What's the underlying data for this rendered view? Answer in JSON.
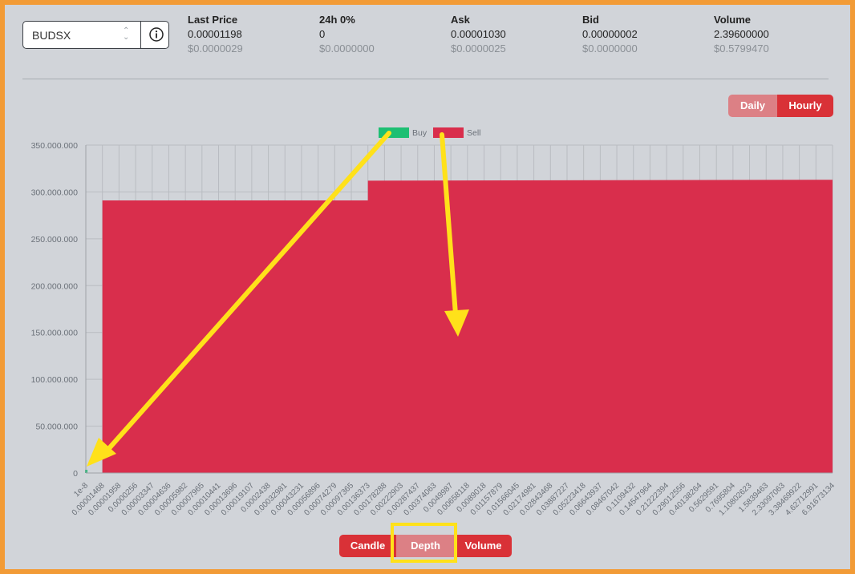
{
  "pair_select": {
    "value": "BUDSX"
  },
  "stats": [
    {
      "label": "Last Price",
      "value": "0.00001198",
      "usd": "$0.0000029"
    },
    {
      "label": "24h 0%",
      "value": "0",
      "usd": "$0.0000000"
    },
    {
      "label": "Ask",
      "value": "0.00001030",
      "usd": "$0.0000025"
    },
    {
      "label": "Bid",
      "value": "0.00000002",
      "usd": "$0.0000000"
    },
    {
      "label": "Volume",
      "value": "2.39600000",
      "usd": "$0.5799470"
    }
  ],
  "period_toggle": {
    "daily": "Daily",
    "hourly": "Hourly",
    "active": "Hourly"
  },
  "chart_tabs": {
    "candle": "Candle",
    "depth": "Depth",
    "volume": "Volume",
    "active": "Depth"
  },
  "colors": {
    "accent": "#d93137",
    "accent_light": "#dc8085",
    "buy": "#1dbf73",
    "sell": "#d92e4c",
    "annotation": "#ffe11a"
  },
  "chart_data": {
    "type": "area",
    "legend": [
      {
        "name": "Buy",
        "color": "#1dbf73"
      },
      {
        "name": "Sell",
        "color": "#d92e4c"
      }
    ],
    "legend_position": "top-center",
    "grid": true,
    "ylim": [
      0,
      350000000
    ],
    "yticks": [
      "350.000.000",
      "300.000.000",
      "250.000.000",
      "200.000.000",
      "150.000.000",
      "100.000.000",
      "50.000.000",
      "0"
    ],
    "xticks": [
      "1e-8",
      "0.00001468",
      "0.00001958",
      "0.0000256",
      "0.00003347",
      "0.00004636",
      "0.00005982",
      "0.00007965",
      "0.00010441",
      "0.00013696",
      "0.00019107",
      "0.0002438",
      "0.00032981",
      "0.00043231",
      "0.00056896",
      "0.00074279",
      "0.00097365",
      "0.00136373",
      "0.00178288",
      "0.00222903",
      "0.00287437",
      "0.00374063",
      "0.0049987",
      "0.00658118",
      "0.0089018",
      "0.01157879",
      "0.01566045",
      "0.02174981",
      "0.02843468",
      "0.03887227",
      "0.05223418",
      "0.06643937",
      "0.08467042",
      "0.1109432",
      "0.14547964",
      "0.21222394",
      "0.29012556",
      "0.40138264",
      "0.5629591",
      "0.7695804",
      "1.10802623",
      "1.5839463",
      "2.33097063",
      "3.38469922",
      "4.62712991",
      "6.91673134"
    ],
    "series": [
      {
        "name": "Buy",
        "values": [
          {
            "x": "1e-8",
            "y": 0
          }
        ]
      },
      {
        "name": "Sell",
        "values": [
          {
            "x": "0.00001468",
            "y": 271000000
          },
          {
            "x": "0.00001468",
            "y": 291000000
          },
          {
            "x": "0.00136373",
            "y": 291000000
          },
          {
            "x": "0.00136373",
            "y": 312000000
          },
          {
            "x": "6.91673134",
            "y": 313000000
          }
        ]
      }
    ]
  }
}
